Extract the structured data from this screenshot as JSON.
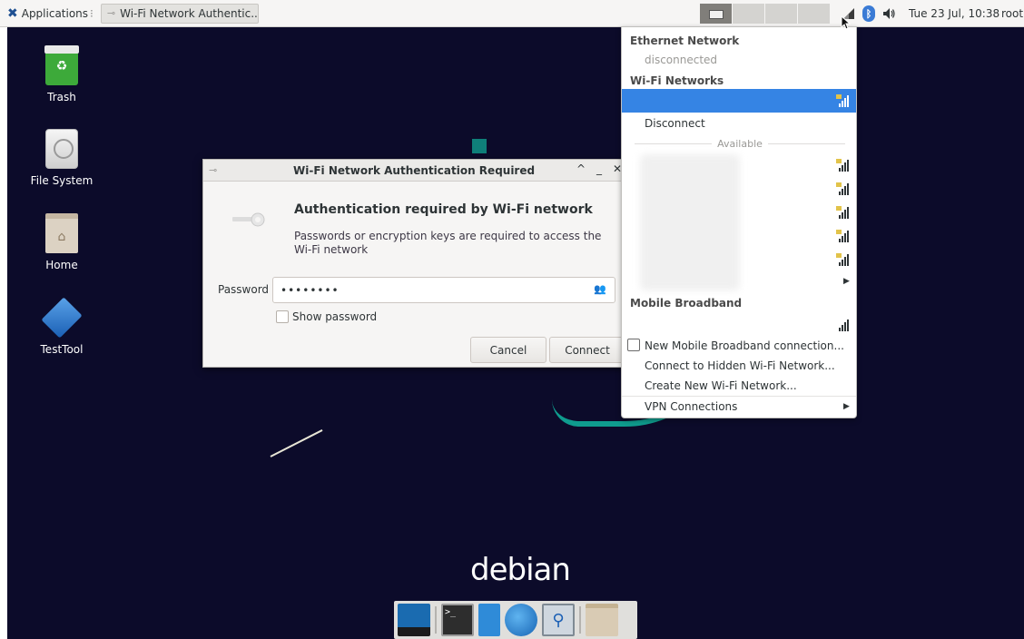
{
  "panel": {
    "apps_label": "Applications",
    "window_task_label": "Wi-Fi Network Authentic...",
    "clock": "Tue 23 Jul, 10:38",
    "user": "root"
  },
  "desktop": {
    "icons": [
      {
        "label": "Trash"
      },
      {
        "label": "File System"
      },
      {
        "label": "Home"
      },
      {
        "label": "TestTool"
      }
    ],
    "logo_text": "debian"
  },
  "dialog": {
    "title": "Wi-Fi Network Authentication Required",
    "heading": "Authentication required by Wi-Fi network",
    "description": "Passwords or encryption keys are required to access the Wi-Fi network",
    "password_label": "Password",
    "password_value": "••••••••",
    "show_password_label": "Show password",
    "cancel_label": "Cancel",
    "connect_label": "Connect",
    "title_buttons": {
      "up": "^",
      "min": "_",
      "close": "✕"
    }
  },
  "network_menu": {
    "ethernet_header": "Ethernet Network",
    "ethernet_status": "disconnected",
    "wifi_header": "Wi-Fi Networks",
    "disconnect_label": "Disconnect",
    "available_label": "Available",
    "mobile_header": "Mobile Broadband",
    "new_mobile_label": "New Mobile Broadband connection...",
    "hidden_wifi_label": "Connect to Hidden Wi-Fi Network...",
    "create_wifi_label": "Create New Wi-Fi Network...",
    "vpn_label": "VPN Connections"
  },
  "colors": {
    "accent": "#3584e4",
    "desktop_bg": "#0c0b2a",
    "debian_teal": "#0f9c8e"
  }
}
